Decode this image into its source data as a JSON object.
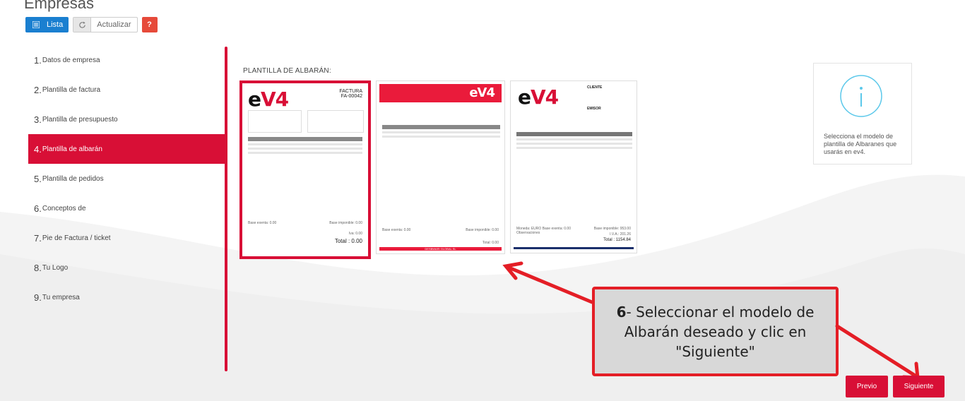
{
  "header": {
    "title": "Empresas"
  },
  "toolbar": {
    "list_label": "Lista",
    "refresh_label": "Actualizar",
    "help_label": "?"
  },
  "steps": [
    {
      "num": "1.",
      "label": "Datos de empresa",
      "active": false
    },
    {
      "num": "2.",
      "label": "Plantilla de factura",
      "active": false
    },
    {
      "num": "3.",
      "label": "Plantilla de presupuesto",
      "active": false
    },
    {
      "num": "4.",
      "label": "Plantilla de albarán",
      "active": true
    },
    {
      "num": "5.",
      "label": "Plantilla de pedidos",
      "active": false
    },
    {
      "num": "6.",
      "label": "Conceptos de",
      "active": false
    },
    {
      "num": "7.",
      "label": "Pie de Factura / ticket",
      "active": false
    },
    {
      "num": "8.",
      "label": "Tu Logo",
      "active": false
    },
    {
      "num": "9.",
      "label": "Tu empresa",
      "active": false
    }
  ],
  "section": {
    "title": "PLANTILLA DE ALBARÁN:"
  },
  "templates": [
    {
      "selected": true,
      "logo": "eV4",
      "doc_type": "FACTURA",
      "doc_number": "FA-00042",
      "base_exenta": "Base exenta: 0.00",
      "base_imponible": "Base imponible: 0.00",
      "iva": "Iva: 0.00",
      "total": "Total : 0.00"
    },
    {
      "selected": false,
      "logo": "eV4",
      "base_exenta": "Base exenta: 0.00",
      "base_imponible": "Base imponible: 0.00",
      "total": "Total: 0.00",
      "footer": "DESBWARI GLOBAL SL"
    },
    {
      "selected": false,
      "logo": "eV4",
      "cliente": "CLIENTE",
      "emisor": "EMISOR",
      "moneda": "Moneda: EURO Base exenta: 0.00",
      "observaciones": "Observaciones",
      "base_imponible": "Base imponible: 953.00",
      "iva": "I.V.A.: 201.26",
      "total": "Total : 1154.84"
    }
  ],
  "info": {
    "text": "Selecciona el modelo de plantilla de Albaranes que usarás en ev4."
  },
  "callout": {
    "step": "6",
    "text": "- Seleccionar el modelo de Albarán deseado y clic en \"Siguiente\""
  },
  "nav": {
    "prev_label": "Previo",
    "next_label": "Siguiente"
  },
  "colors": {
    "accent": "#d80f36",
    "primary": "#1a7fd0",
    "help": "#e64a3a",
    "callout_border": "#e41e26",
    "callout_bg": "#d8d8d8"
  }
}
